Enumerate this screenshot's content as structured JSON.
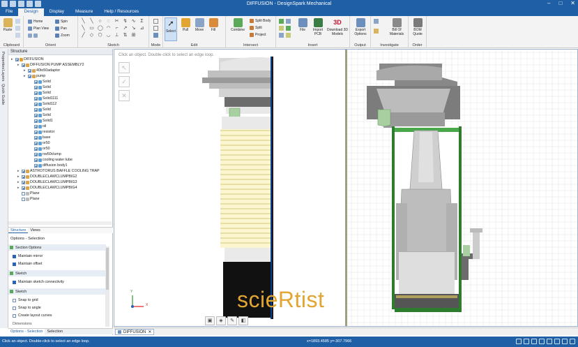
{
  "app": {
    "window_title": "DIFFUSION - DesignSpark Mechanical",
    "window_controls": [
      "–",
      "□",
      "✕"
    ]
  },
  "menu": {
    "items": [
      "File",
      "Design",
      "Display",
      "Measure",
      "Help / Resources"
    ],
    "active": "Design"
  },
  "ribbon": {
    "clipboard": {
      "label": "Clipboard",
      "paste": "Paste"
    },
    "orient": {
      "label": "Orient",
      "home": "Home",
      "plan_view": "Plan View",
      "spin": "Spin",
      "pan": "Pan",
      "zoom": "Zoom"
    },
    "sketch": {
      "label": "Sketch"
    },
    "mode": {
      "label": "Mode"
    },
    "edit": {
      "label": "Edit",
      "select": "Select",
      "pull": "Pull",
      "move": "Move",
      "fill": "Fill"
    },
    "intersect": {
      "label": "Intersect",
      "combine": "Combine",
      "split_body": "Split Body",
      "split": "Split",
      "project": "Project"
    },
    "insert": {
      "label": "Insert",
      "file": "File",
      "import_pcb_1": "Import",
      "import_pcb_2": "PCB",
      "download_1": "Download 3D",
      "download_2": "Models",
      "badge_3d": "3D"
    },
    "output": {
      "label": "Output",
      "export_1": "Export",
      "export_2": "Options"
    },
    "investigate": {
      "label": "Investigate",
      "bom_1": "Bill Of",
      "bom_2": "Materials"
    },
    "order": {
      "label": "Order",
      "quote_1": "BOM",
      "quote_2": "Quote"
    }
  },
  "side_tabs": [
    "Properties",
    "Layers",
    "Quick Guide"
  ],
  "structure": {
    "title": "Structure",
    "items": [
      {
        "label": "DIFFUSION",
        "indent": 0,
        "checked": true,
        "icon": "assembly-icon"
      },
      {
        "label": "DIFFUSION PUMP ASSEMBLY2",
        "indent": 1,
        "checked": true,
        "icon": "component-icon"
      },
      {
        "label": "40to50adaptor",
        "indent": 2,
        "checked": true,
        "icon": "component-icon"
      },
      {
        "label": "pump",
        "indent": 2,
        "checked": true,
        "icon": "component-icon"
      },
      {
        "label": "Solid",
        "indent": 3,
        "checked": true,
        "icon": "solid-icon"
      },
      {
        "label": "Solid",
        "indent": 3,
        "checked": true,
        "icon": "solid-icon"
      },
      {
        "label": "Solid",
        "indent": 3,
        "checked": true,
        "icon": "solid-icon"
      },
      {
        "label": "Solid1111",
        "indent": 3,
        "checked": true,
        "icon": "solid-icon"
      },
      {
        "label": "Solid112",
        "indent": 3,
        "checked": true,
        "icon": "solid-icon"
      },
      {
        "label": "Solid",
        "indent": 3,
        "checked": true,
        "icon": "solid-icon"
      },
      {
        "label": "Solid",
        "indent": 3,
        "checked": true,
        "icon": "solid-icon"
      },
      {
        "label": "Solid1",
        "indent": 3,
        "checked": true,
        "icon": "solid-icon"
      },
      {
        "label": "oil",
        "indent": 3,
        "checked": true,
        "icon": "solid-icon"
      },
      {
        "label": "resistor",
        "indent": 3,
        "checked": true,
        "icon": "solid-icon"
      },
      {
        "label": "base",
        "indent": 3,
        "checked": true,
        "icon": "solid-icon"
      },
      {
        "label": "or50",
        "indent": 3,
        "checked": true,
        "icon": "solid-icon"
      },
      {
        "label": "or50",
        "indent": 3,
        "checked": true,
        "icon": "solid-icon"
      },
      {
        "label": "nw50clump",
        "indent": 3,
        "checked": true,
        "icon": "solid-icon"
      },
      {
        "label": "cooling water tube",
        "indent": 3,
        "checked": true,
        "icon": "solid-icon"
      },
      {
        "label": "diffusion body1",
        "indent": 3,
        "checked": true,
        "icon": "solid-icon"
      },
      {
        "label": "ASTROTORUS BAFFLE COOLING TRAP",
        "indent": 1,
        "checked": true,
        "icon": "component-icon"
      },
      {
        "label": "DOUBLECLAWCLUMPBIG2",
        "indent": 1,
        "checked": true,
        "icon": "component-icon"
      },
      {
        "label": "DOUBLECLAWCLUMPBIG3",
        "indent": 1,
        "checked": true,
        "icon": "component-icon"
      },
      {
        "label": "DOUBLECLAWCLUMPBIG4",
        "indent": 1,
        "checked": true,
        "icon": "component-icon"
      },
      {
        "label": "Plane",
        "indent": 1,
        "checked": false,
        "icon": "plane-icon"
      },
      {
        "label": "Plane",
        "indent": 1,
        "checked": false,
        "icon": "plane-icon"
      }
    ]
  },
  "panel_tabs": {
    "structure": "Structure",
    "views": "Views"
  },
  "options": {
    "title": "Options - Selection",
    "section_options": "Section Options",
    "maintain_mirror": "Maintain mirror",
    "maintain_offset": "Maintain offset",
    "sketch": "Sketch",
    "maintain_sketch": "Maintain sketch connectivity",
    "sketch2": "Sketch",
    "snap_grid": "Snap to grid",
    "snap_angle": "Snap to angle",
    "create_layout": "Create layout curves",
    "dimensions": "Dimensions"
  },
  "bottom_tabs": {
    "options": "Options - Selection",
    "selection": "Selection"
  },
  "viewport": {
    "hint": "Click an object. Double-click to select an edge loop.",
    "watermark": "scieRtist",
    "axis_y": "Y",
    "axis_x": "X"
  },
  "doc_tab": {
    "label": "DIFFUSION",
    "close": "✕"
  },
  "status": {
    "message": "Click an object. Double-click to select an edge loop.",
    "coords": "x=1893.4585  y=-307.7966"
  },
  "colors": {
    "brand": "#1f5fa6",
    "thread_yellow": "#fbf6cf",
    "clamp_green": "#a8cfa0",
    "section_green": "#4aa84a"
  }
}
